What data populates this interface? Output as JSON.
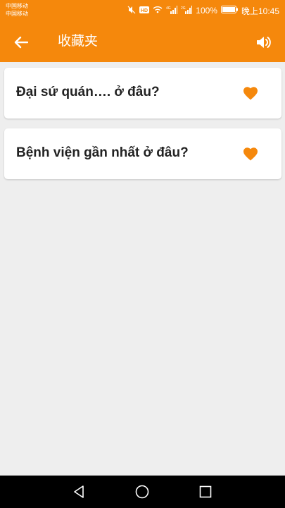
{
  "status_bar": {
    "carrier_1": "中国移动",
    "carrier_2": "中国移动",
    "battery": "100%",
    "time": "晚上10:45"
  },
  "app_bar": {
    "title": "收藏夹"
  },
  "favorites": [
    {
      "text": "Đại sứ quán…. ở đâu?",
      "favorited": true
    },
    {
      "text": "Bệnh viện gần nhất ở đâu?",
      "favorited": true
    }
  ],
  "colors": {
    "accent": "#f5880c",
    "background": "#eeeeee",
    "card": "#ffffff"
  }
}
